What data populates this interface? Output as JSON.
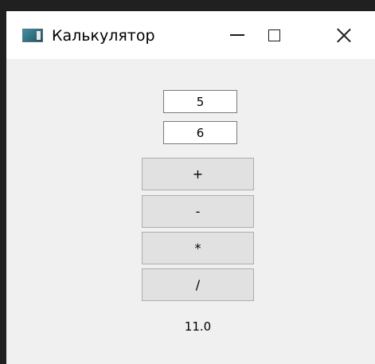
{
  "window": {
    "title": "Калькулятор",
    "icon": "app-window-icon",
    "controls": {
      "minimize_icon": "minimize-icon",
      "maximize_icon": "maximize-icon",
      "close_icon": "close-icon"
    }
  },
  "inputs": {
    "first_value": "5",
    "second_value": "6"
  },
  "operations": {
    "add_label": "+",
    "subtract_label": "-",
    "multiply_label": "*",
    "divide_label": "/"
  },
  "result": {
    "value": "11.0"
  },
  "colors": {
    "window_background": "#f0f0f0",
    "titlebar_background": "#ffffff",
    "button_background": "#e1e1e1",
    "button_border": "#adadad"
  }
}
